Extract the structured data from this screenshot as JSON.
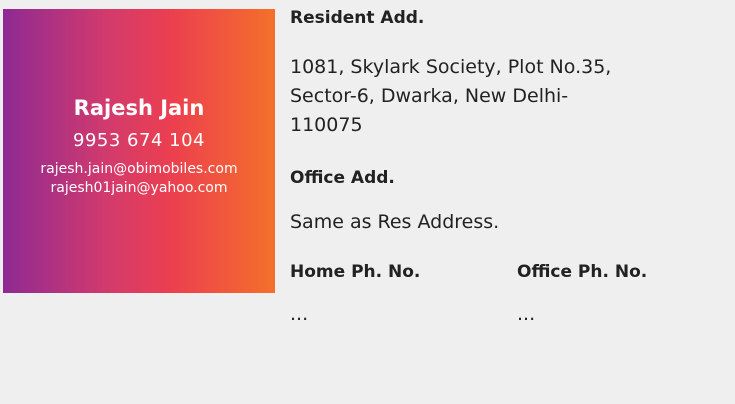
{
  "contact": {
    "name": "Rajesh Jain",
    "phone": "9953 674 104",
    "email_primary": "rajesh.jain@obimobiles.com",
    "email_secondary": "rajesh01jain@yahoo.com",
    "gradient_colors": [
      "#8e2a93",
      "#d23a6d",
      "#ec3f4f",
      "#f4702a"
    ]
  },
  "details": {
    "resident_label": "Resident Add.",
    "resident_line1": "1081, Skylark Society, Plot No.35,",
    "resident_line2": "Sector-6, Dwarka, New Delhi-",
    "resident_line3": "110075",
    "office_label": "Office Add.",
    "office_value": "Same as Res Address.",
    "home_phone_label": "Home Ph. No.",
    "home_phone_value": "...",
    "office_phone_label": "Office Ph. No.",
    "office_phone_value": "..."
  }
}
